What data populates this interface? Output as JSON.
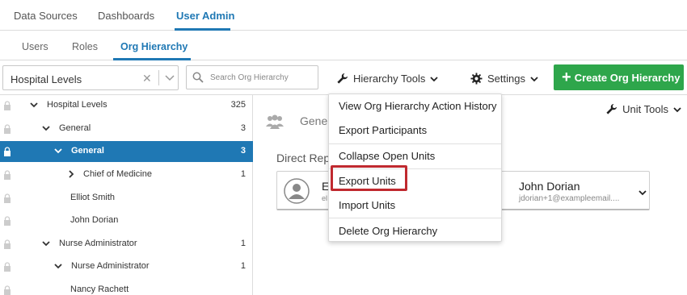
{
  "top_nav": {
    "tabs": [
      {
        "label": "Data Sources"
      },
      {
        "label": "Dashboards"
      },
      {
        "label": "User Admin"
      }
    ]
  },
  "sub_nav": {
    "tabs": [
      {
        "label": "Users"
      },
      {
        "label": "Roles"
      },
      {
        "label": "Org Hierarchy"
      }
    ]
  },
  "toolbar": {
    "org_select_value": "Hospital Levels",
    "search_placeholder": "Search Org Hierarchy",
    "hierarchy_tools_label": "Hierarchy Tools",
    "settings_label": "Settings",
    "create_label": "Create Org Hierarchy"
  },
  "tree": {
    "rows": [
      {
        "label": "Hospital Levels",
        "count": "325"
      },
      {
        "label": "General",
        "count": "3"
      },
      {
        "label": "General",
        "count": "3"
      },
      {
        "label": "Chief of Medicine",
        "count": "1"
      },
      {
        "label": "Elliot Smith",
        "count": ""
      },
      {
        "label": "John Dorian",
        "count": ""
      },
      {
        "label": "Nurse Administrator",
        "count": "1"
      },
      {
        "label": "Nurse Administrator",
        "count": "1"
      },
      {
        "label": "Nancy Rachett",
        "count": ""
      }
    ]
  },
  "detail": {
    "unit_title": "Gener",
    "direct_reports_label": "Direct Rep",
    "unit_tools_label": "Unit Tools",
    "person1_name": "E",
    "person1_email": "el",
    "person2_name": "John Dorian",
    "person2_email": "jdorian+1@exampleemail...."
  },
  "dropdown": {
    "items": [
      {
        "label": "View Org Hierarchy Action History"
      },
      {
        "label": "Export Participants"
      },
      {
        "label": "Collapse Open Units"
      },
      {
        "label": "Export Units"
      },
      {
        "label": "Import Units"
      },
      {
        "label": "Delete Org Hierarchy"
      }
    ]
  },
  "colors": {
    "accent": "#1f78b4",
    "create_button": "#2ea64b",
    "highlight": "#c0292f"
  },
  "icons": [
    "chevron-down-icon",
    "chevron-right-icon",
    "search-icon",
    "wrench-icon",
    "gear-icon",
    "plus-icon",
    "lock-icon",
    "people-icon",
    "user-avatar-icon"
  ]
}
